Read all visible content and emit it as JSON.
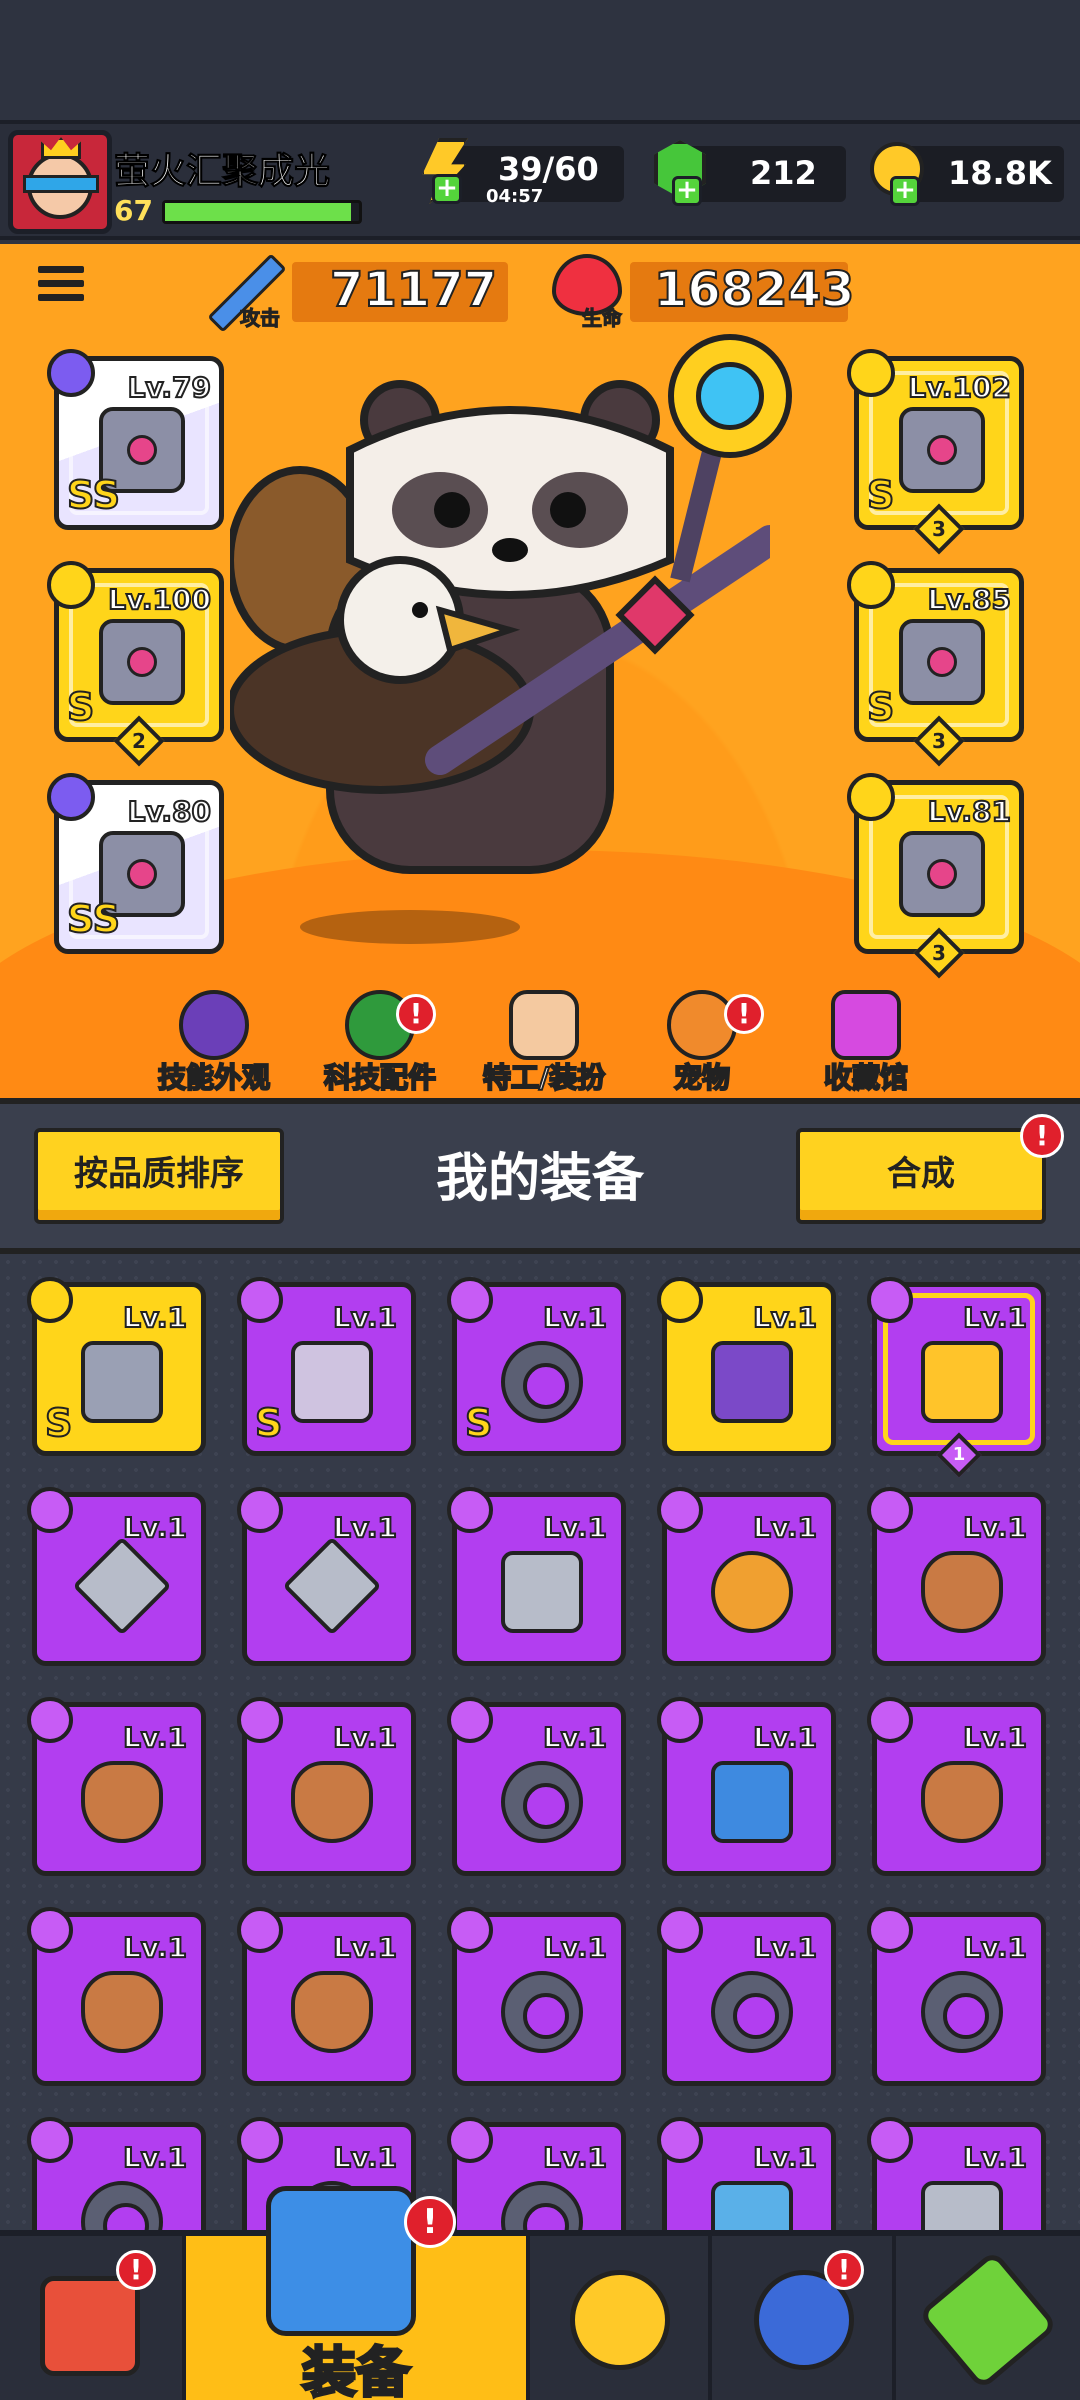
{
  "player": {
    "name": "萤火汇聚成光",
    "level": "67",
    "level_progress": 0.96
  },
  "resources": {
    "energy": "39/60",
    "energy_timer": "04:57",
    "gems": "212",
    "coins": "18.8K"
  },
  "stats": {
    "attack_value": "71177",
    "attack_label": "攻击",
    "hp_value": "168243",
    "hp_label": "生命"
  },
  "equipped": {
    "left": [
      {
        "level": "Lv.79",
        "grade": "SS",
        "stars": ""
      },
      {
        "level": "Lv.100",
        "grade": "S",
        "stars": "2"
      },
      {
        "level": "Lv.80",
        "grade": "SS",
        "stars": ""
      }
    ],
    "right": [
      {
        "level": "Lv.102",
        "grade": "S",
        "stars": "3"
      },
      {
        "level": "Lv.85",
        "grade": "S",
        "stars": "3"
      },
      {
        "level": "Lv.81",
        "grade": "",
        "stars": "3"
      }
    ]
  },
  "shortcuts": [
    {
      "label": "技能外观",
      "badge": ""
    },
    {
      "label": "科技配件",
      "badge": "!"
    },
    {
      "label": "特工/装扮",
      "badge": ""
    },
    {
      "label": "宠物",
      "badge": "!"
    },
    {
      "label": "收藏馆",
      "badge": ""
    }
  ],
  "inventory": {
    "sort_button": "按品质排序",
    "title": "我的装备",
    "merge_button": "合成",
    "merge_badge": "!",
    "items": [
      {
        "level": "Lv.1",
        "grade": "S"
      },
      {
        "level": "Lv.1",
        "grade": "S"
      },
      {
        "level": "Lv.1",
        "grade": "S"
      },
      {
        "level": "Lv.1",
        "grade": ""
      },
      {
        "level": "Lv.1",
        "grade": "",
        "stars": "1"
      },
      {
        "level": "Lv.1"
      },
      {
        "level": "Lv.1"
      },
      {
        "level": "Lv.1"
      },
      {
        "level": "Lv.1"
      },
      {
        "level": "Lv.1"
      },
      {
        "level": "Lv.1"
      },
      {
        "level": "Lv.1"
      },
      {
        "level": "Lv.1"
      },
      {
        "level": "Lv.1"
      },
      {
        "level": "Lv.1"
      },
      {
        "level": "Lv.1"
      },
      {
        "level": "Lv.1"
      },
      {
        "level": "Lv.1"
      },
      {
        "level": "Lv.1"
      },
      {
        "level": "Lv.1"
      },
      {
        "level": "Lv.1"
      },
      {
        "level": "Lv.1"
      },
      {
        "level": "Lv.1"
      },
      {
        "level": "Lv.1"
      },
      {
        "level": "Lv.1"
      }
    ]
  },
  "bottom_nav": {
    "active_label": "装备",
    "shop_badge": "!",
    "equip_badge": "!",
    "orb_badge": "!"
  },
  "colors": {
    "hero_bg": "#ffa31f",
    "epic": "#b23ef0",
    "legendary": "#ffd51a",
    "accent_yellow": "#ffd21f",
    "badge_red": "#e0202c"
  }
}
